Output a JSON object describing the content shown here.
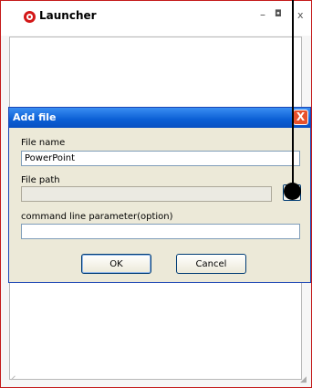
{
  "launcher": {
    "title": "Launcher",
    "controls": {
      "minimize": "–",
      "maximize": "◘",
      "close": "x"
    }
  },
  "dialog": {
    "title": "Add file",
    "close_glyph": "X",
    "file_name_label": "File name",
    "file_name_value": "PowerPoint",
    "file_path_label": "File path",
    "file_path_value": "",
    "browse_label": "...",
    "param_label": "command line parameter(option)",
    "param_value": "",
    "ok_label": "OK",
    "cancel_label": "Cancel"
  },
  "colors": {
    "launcher_border": "#c41a1a",
    "dialog_titlebar": "#0a5ed4",
    "dialog_close": "#e6512c",
    "dialog_body": "#ece9d8"
  }
}
